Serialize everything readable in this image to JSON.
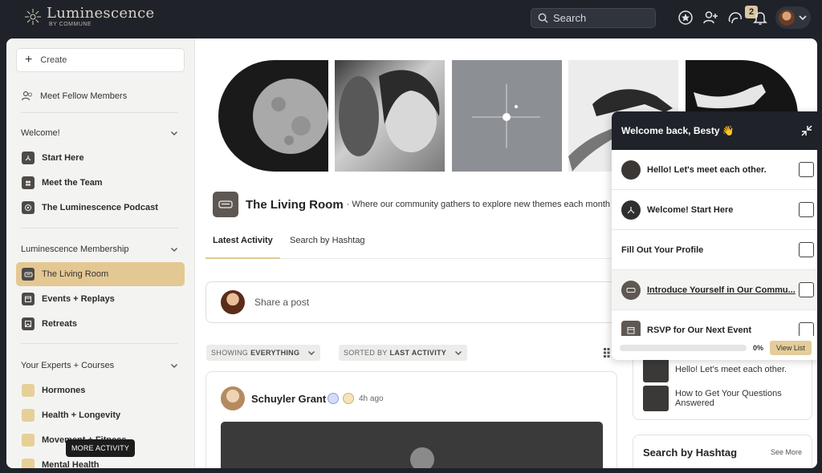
{
  "brand": {
    "name": "Luminescence",
    "sub": "BY COMMUNE"
  },
  "topbar": {
    "search_placeholder": "Search",
    "notification_count": "2"
  },
  "sidebar": {
    "create_label": "Create",
    "meet_members": "Meet Fellow Members",
    "sections": [
      {
        "title": "Welcome!",
        "items": [
          "Start Here",
          "Meet the Team",
          "The Luminescence Podcast"
        ]
      },
      {
        "title": "Luminescence Membership",
        "items": [
          "The Living Room",
          "Events + Replays",
          "Retreats"
        ]
      },
      {
        "title": "Your Experts + Courses",
        "items": [
          "Hormones",
          "Health + Longevity",
          "Movement + Fitness",
          "Mental Health"
        ]
      }
    ],
    "tooltip": "MORE ACTIVITY"
  },
  "room": {
    "title": "The Living Room",
    "description": "· Where our community gathers to explore new themes each month"
  },
  "tabs": [
    "Latest Activity",
    "Search by Hashtag"
  ],
  "composer": {
    "placeholder": "Share a post"
  },
  "filters": {
    "showing_prefix": "SHOWING",
    "showing_value": "EVERYTHING",
    "sorted_prefix": "SORTED BY",
    "sorted_value": "LAST ACTIVITY"
  },
  "post": {
    "author": "Schuyler Grant",
    "time": "4h ago"
  },
  "right_panel": {
    "items": [
      "Hello! Let's meet each other.",
      "How to Get Your Questions Answered"
    ],
    "hashtag_title": "Search by Hashtag",
    "see_more": "See More"
  },
  "welcome_panel": {
    "title": "Welcome back, Besty 👋",
    "tasks": [
      "Hello! Let's meet each other.",
      "Welcome! Start Here",
      "Fill Out Your Profile",
      "Introduce Yourself in Our Commu...",
      "RSVP for Our Next Event"
    ],
    "progress": 0,
    "progress_label": "0%",
    "view_list": "View List"
  },
  "colors": {
    "accent": "#e4c893",
    "topbar": "#1f2229"
  }
}
